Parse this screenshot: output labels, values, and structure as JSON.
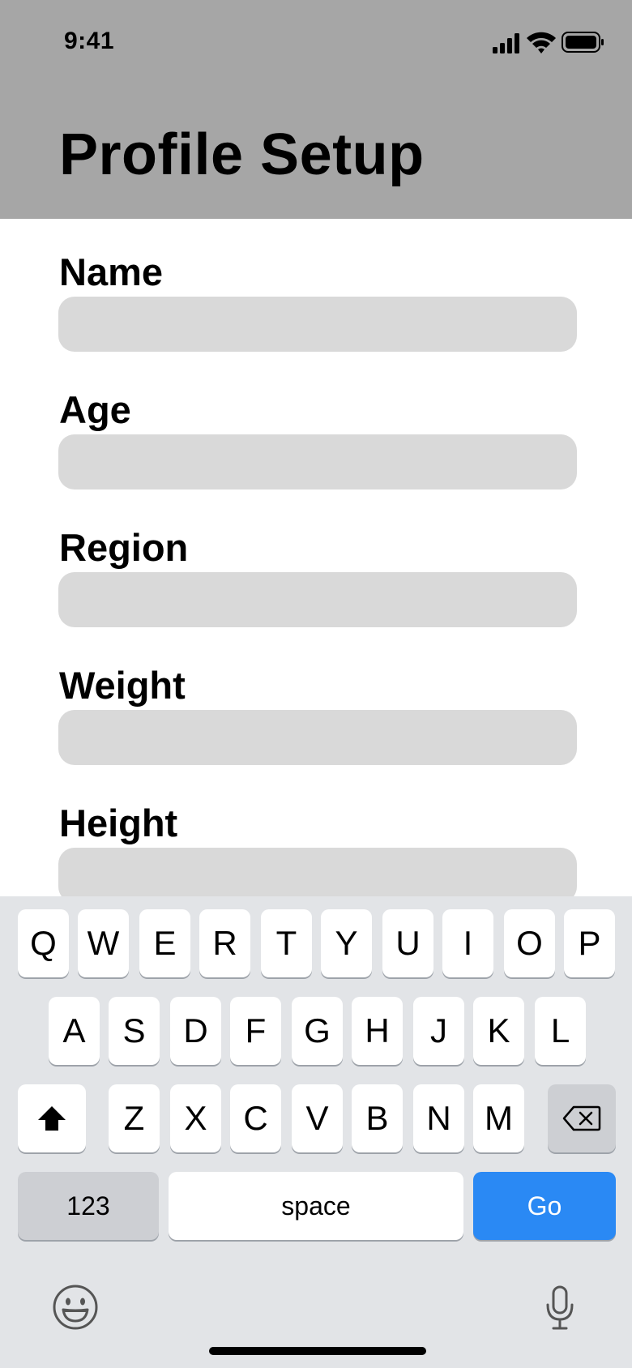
{
  "status_bar": {
    "time": "9:41",
    "icons": [
      "signal-icon",
      "wifi-icon",
      "battery-icon"
    ]
  },
  "header": {
    "title": "Profile Setup",
    "background": "#a6a6a6"
  },
  "form": {
    "fields": [
      {
        "label": "Name",
        "value": "",
        "placeholder": ""
      },
      {
        "label": "Age",
        "value": "",
        "placeholder": ""
      },
      {
        "label": "Region",
        "value": "",
        "placeholder": ""
      },
      {
        "label": "Weight",
        "value": "",
        "placeholder": ""
      },
      {
        "label": "Height",
        "value": "",
        "placeholder": ""
      }
    ]
  },
  "keyboard": {
    "row1": [
      "Q",
      "W",
      "E",
      "R",
      "T",
      "Y",
      "U",
      "I",
      "O",
      "P"
    ],
    "row2": [
      "A",
      "S",
      "D",
      "F",
      "G",
      "H",
      "J",
      "K",
      "L"
    ],
    "row3": [
      "Z",
      "X",
      "C",
      "V",
      "B",
      "N",
      "M"
    ],
    "shift_icon": "shift-icon",
    "delete_icon": "backspace-icon",
    "numbers_label": "123",
    "space_label": "space",
    "go_label": "Go",
    "emoji_icon": "emoji-icon",
    "mic_icon": "microphone-icon",
    "go_color": "#2a89f4"
  }
}
